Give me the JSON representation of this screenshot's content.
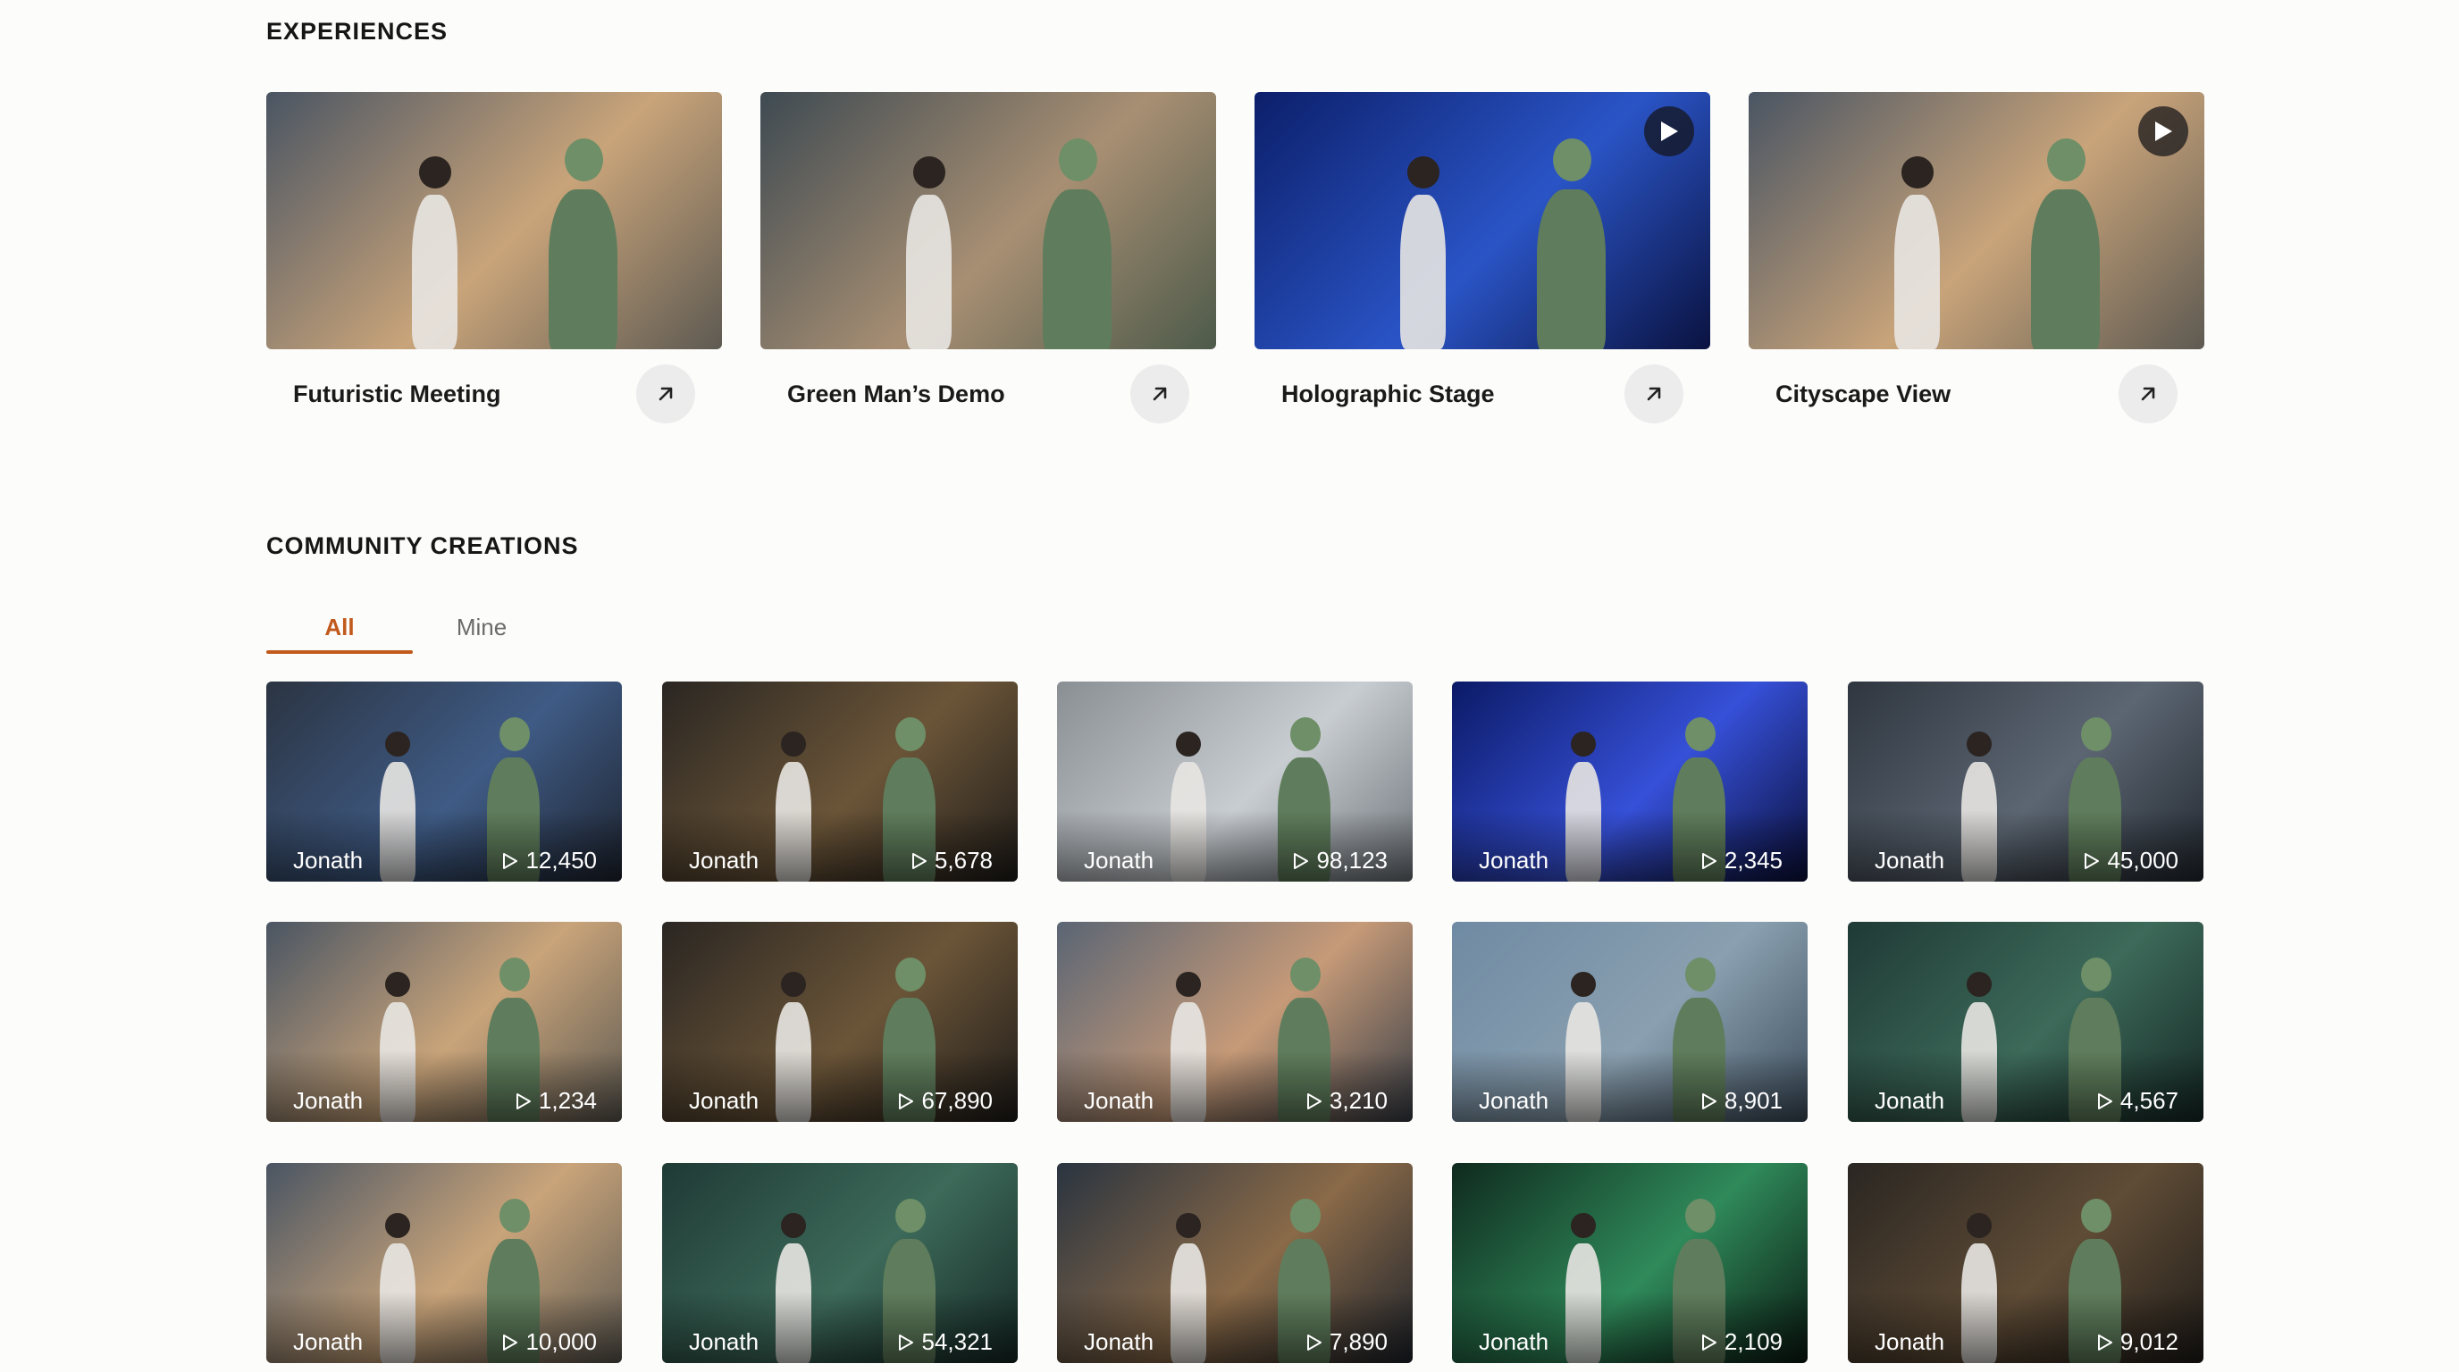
{
  "experiences": {
    "title": "EXPERIENCES",
    "cards": [
      {
        "label": "Futuristic Meeting",
        "bg": [
          "#4a5563",
          "#c9a47a",
          "#5e5a52"
        ],
        "has_play": false
      },
      {
        "label": "Green Man’s Demo",
        "bg": [
          "#3e4a52",
          "#a88f73",
          "#4d5a4a"
        ],
        "has_play": false
      },
      {
        "label": "Holographic Stage",
        "bg": [
          "#0c1f6a",
          "#2a54c6",
          "#0a1240"
        ],
        "has_play": true
      },
      {
        "label": "Cityscape View",
        "bg": [
          "#4a5563",
          "#c9a47a",
          "#5e5a52"
        ],
        "has_play": true
      }
    ]
  },
  "community": {
    "title": "COMMUNITY CREATIONS",
    "tabs": {
      "all": "All",
      "mine": "Mine"
    },
    "cards": [
      {
        "author": "Jonath",
        "views": "12,450",
        "bg": [
          "#2b3442",
          "#3f5b85",
          "#1e2430"
        ]
      },
      {
        "author": "Jonath",
        "views": "5,678",
        "bg": [
          "#2a2622",
          "#6b5538",
          "#1f1c19"
        ]
      },
      {
        "author": "Jonath",
        "views": "98,123",
        "bg": [
          "#8a8f94",
          "#c8cdd1",
          "#6f757b"
        ]
      },
      {
        "author": "Jonath",
        "views": "2,345",
        "bg": [
          "#0b1a66",
          "#3650d8",
          "#0a0f3a"
        ]
      },
      {
        "author": "Jonath",
        "views": "45,000",
        "bg": [
          "#2f3640",
          "#5c6672",
          "#222830"
        ]
      },
      {
        "author": "Jonath",
        "views": "1,234",
        "bg": [
          "#4a5563",
          "#c9a47a",
          "#5e5a52"
        ]
      },
      {
        "author": "Jonath",
        "views": "67,890",
        "bg": [
          "#2a2622",
          "#6b5538",
          "#1f1c19"
        ]
      },
      {
        "author": "Jonath",
        "views": "3,210",
        "bg": [
          "#5a6574",
          "#c69a78",
          "#3a3f47"
        ]
      },
      {
        "author": "Jonath",
        "views": "8,901",
        "bg": [
          "#6f8aa3",
          "#8aa0b0",
          "#3e4e5d"
        ]
      },
      {
        "author": "Jonath",
        "views": "4,567",
        "bg": [
          "#1f3a35",
          "#3d6a5a",
          "#152824"
        ]
      },
      {
        "author": "Jonath",
        "views": "10,000",
        "bg": [
          "#4a5563",
          "#c9a47a",
          "#5e5a52"
        ]
      },
      {
        "author": "Jonath",
        "views": "54,321",
        "bg": [
          "#1f3a35",
          "#3d6a5a",
          "#152824"
        ]
      },
      {
        "author": "Jonath",
        "views": "7,890",
        "bg": [
          "#2a3440",
          "#8a6a48",
          "#1f242c"
        ]
      },
      {
        "author": "Jonath",
        "views": "2,109",
        "bg": [
          "#0f2a1e",
          "#2f8a5a",
          "#0a1a12"
        ]
      },
      {
        "author": "Jonath",
        "views": "9,012",
        "bg": [
          "#2a2622",
          "#5f4c36",
          "#1f1c19"
        ]
      }
    ]
  },
  "colors": {
    "accent": "#c15a1c",
    "figure_green": "#5f7d5c",
    "figure_white": "#e8e6e2"
  }
}
